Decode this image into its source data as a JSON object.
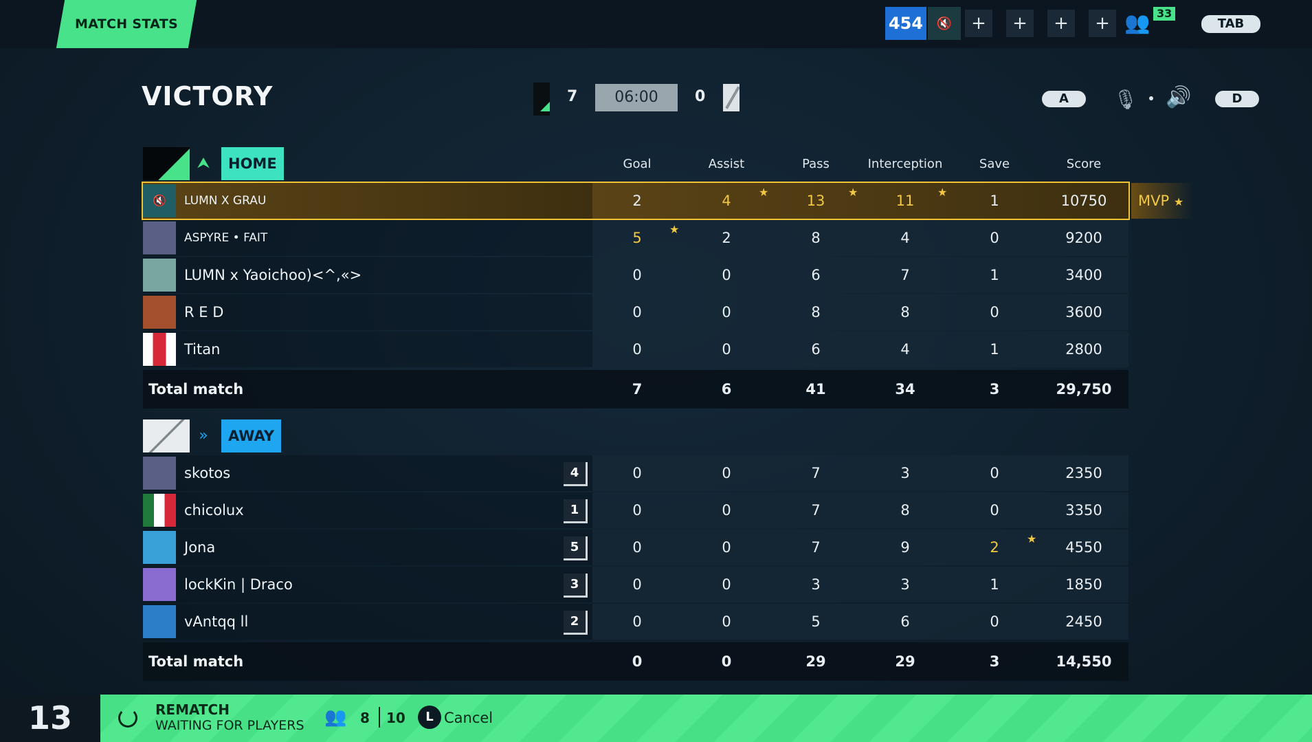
{
  "topbar": {
    "tab_label": "MATCH STATS",
    "currency": "454",
    "party_count": "33",
    "tab_key": "TAB"
  },
  "header": {
    "result": "VICTORY",
    "home_score": "7",
    "timer": "06:00",
    "away_score": "0",
    "key_prev": "A",
    "key_next": "D"
  },
  "columns": [
    "Goal",
    "Assist",
    "Pass",
    "Interception",
    "Save",
    "Score"
  ],
  "home": {
    "label": "HOME",
    "color": "#3de2c0",
    "players": [
      {
        "name": "LUMN X GRAU",
        "stats": [
          "2",
          "4",
          "13",
          "11",
          "1",
          "10750"
        ],
        "avatar": "#1f5f63"
      },
      {
        "name": "ASPYRE • FAIT",
        "stats": [
          "5",
          "2",
          "8",
          "4",
          "0",
          "9200"
        ],
        "avatar": "#5a5f86"
      },
      {
        "name": "LUMN x Yaoichoo)<^,«>",
        "stats": [
          "0",
          "0",
          "6",
          "7",
          "1",
          "3400"
        ],
        "avatar": "#7aa6a2"
      },
      {
        "name": "R E D",
        "stats": [
          "0",
          "0",
          "8",
          "8",
          "0",
          "3600"
        ],
        "avatar": "#a4502c"
      },
      {
        "name": "Titan",
        "stats": [
          "0",
          "0",
          "6",
          "4",
          "1",
          "2800"
        ],
        "avatar": "#d62839"
      }
    ],
    "total_label": "Total match",
    "totals": [
      "7",
      "6",
      "41",
      "34",
      "3",
      "29,750"
    ]
  },
  "away": {
    "label": "AWAY",
    "color": "#1fa6f0",
    "players": [
      {
        "name": "skotos",
        "rank": "4",
        "stats": [
          "0",
          "0",
          "7",
          "3",
          "0",
          "2350"
        ],
        "avatar": "#5a5f86"
      },
      {
        "name": "chicolux",
        "rank": "1",
        "stats": [
          "0",
          "0",
          "7",
          "8",
          "0",
          "3350"
        ],
        "avatar": "#1f7a3c"
      },
      {
        "name": "Jona",
        "rank": "5",
        "stats": [
          "0",
          "0",
          "7",
          "9",
          "2",
          "4550"
        ],
        "avatar": "#3aa0d8"
      },
      {
        "name": "lockKin | Draco",
        "rank": "3",
        "stats": [
          "0",
          "0",
          "3",
          "3",
          "1",
          "1850"
        ],
        "avatar": "#8a6bd0"
      },
      {
        "name": "vAntqq ll",
        "rank": "2",
        "stats": [
          "0",
          "0",
          "5",
          "6",
          "0",
          "2450"
        ],
        "avatar": "#2c7ec8"
      }
    ],
    "total_label": "Total match",
    "totals": [
      "0",
      "0",
      "29",
      "29",
      "3",
      "14,550"
    ]
  },
  "mvp_label": "MVP",
  "footer": {
    "countdown": "13",
    "title": "REMATCH",
    "subtitle": "WAITING FOR PLAYERS",
    "players_ready": "8",
    "players_total": "10",
    "key": "L",
    "cancel_label": "Cancel"
  }
}
